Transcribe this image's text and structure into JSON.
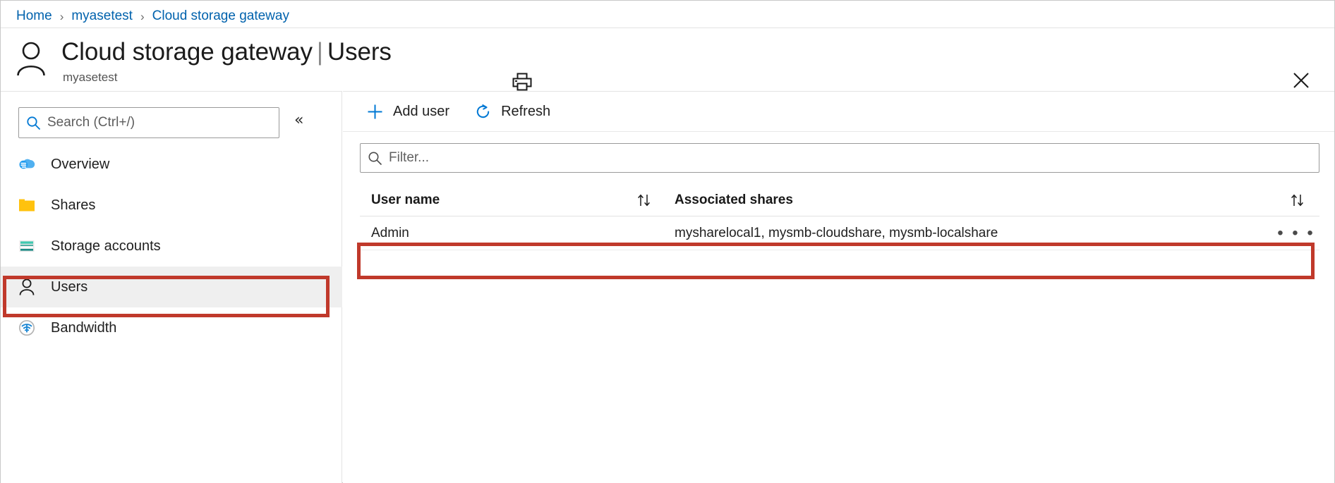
{
  "breadcrumb": {
    "items": [
      {
        "label": "Home"
      },
      {
        "label": "myasetest"
      },
      {
        "label": "Cloud storage gateway"
      }
    ],
    "separator": "›"
  },
  "header": {
    "avatar_icon": "person-icon",
    "resource_title": "Cloud storage gateway",
    "separator": "|",
    "section_title": "Users",
    "subtitle": "myasetest",
    "print_icon": "print-icon",
    "close_icon": "close-icon"
  },
  "sidebar": {
    "search": {
      "icon": "search-icon",
      "placeholder": "Search (Ctrl+/)",
      "value": ""
    },
    "collapse_icon": "«",
    "items": [
      {
        "label": "Overview",
        "icon": "cloud-icon",
        "selected": false
      },
      {
        "label": "Shares",
        "icon": "folder-icon",
        "selected": false
      },
      {
        "label": "Storage accounts",
        "icon": "storage-stack-icon",
        "selected": false
      },
      {
        "label": "Users",
        "icon": "person-icon",
        "selected": true
      },
      {
        "label": "Bandwidth",
        "icon": "bandwidth-wifi-icon",
        "selected": false
      }
    ]
  },
  "toolbar": {
    "add_user_label": "Add user",
    "add_user_icon": "plus-icon",
    "refresh_label": "Refresh",
    "refresh_icon": "refresh-icon"
  },
  "filter": {
    "icon": "search-icon",
    "placeholder": "Filter...",
    "value": ""
  },
  "table": {
    "columns": [
      {
        "label": "User name",
        "sort_icon": "sort-updown-icon"
      },
      {
        "label": "Associated shares",
        "sort_icon": "sort-updown-icon"
      }
    ],
    "rows": [
      {
        "user_name": "Admin",
        "associated_shares": "mysharelocal1, mysmb-cloudshare, mysmb-localshare",
        "menu_icon": "ellipsis-icon",
        "menu_label": "• • •"
      }
    ]
  },
  "annotations": {
    "color": "#c0392b",
    "regions": [
      {
        "name": "sidebar-users-highlight"
      },
      {
        "name": "admin-row-highlight"
      }
    ]
  }
}
